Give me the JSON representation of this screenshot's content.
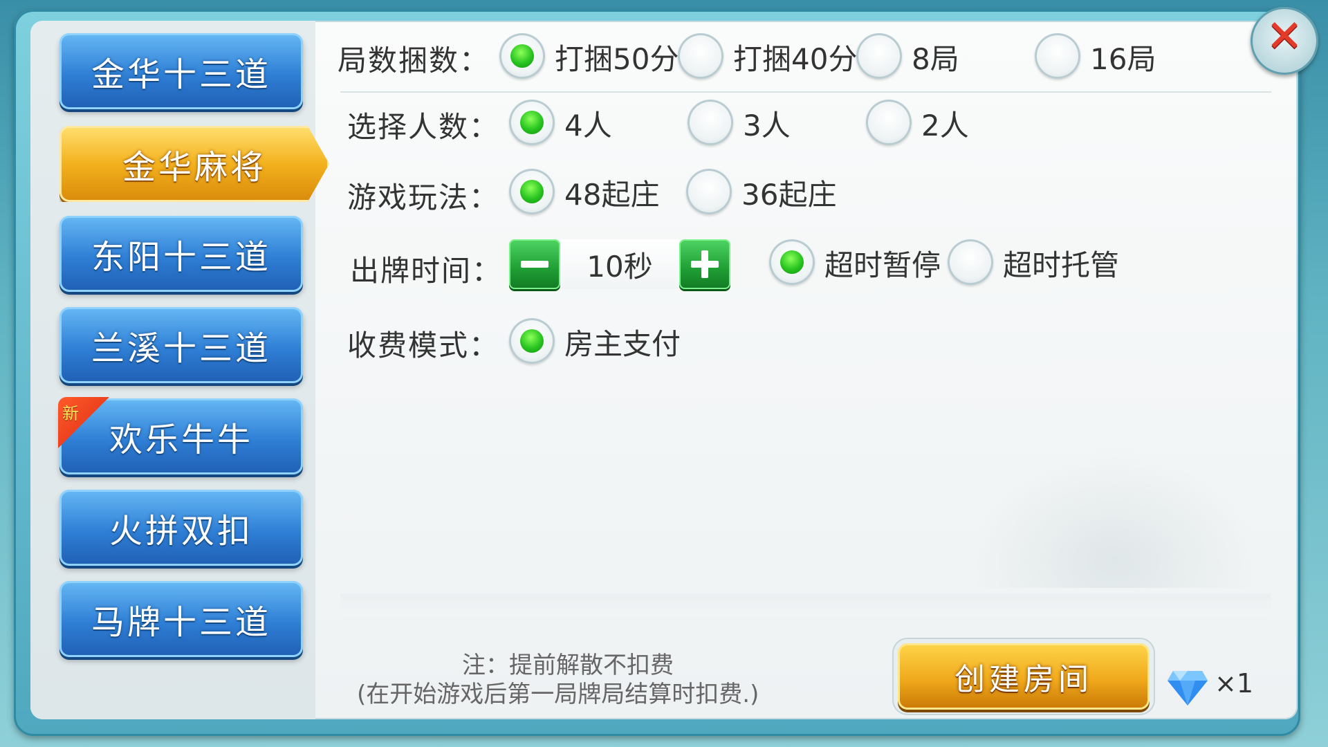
{
  "sidebar": {
    "items": [
      {
        "label": "金华十三道",
        "active": false,
        "new": false
      },
      {
        "label": "金华麻将",
        "active": true,
        "new": false
      },
      {
        "label": "东阳十三道",
        "active": false,
        "new": false
      },
      {
        "label": "兰溪十三道",
        "active": false,
        "new": false
      },
      {
        "label": "欢乐牛牛",
        "active": false,
        "new": true,
        "badge": "新"
      },
      {
        "label": "火拼双扣",
        "active": false,
        "new": false
      },
      {
        "label": "马牌十三道",
        "active": false,
        "new": false
      }
    ]
  },
  "options": {
    "rounds": {
      "label": "局数捆数：",
      "choices": [
        "打捆50分",
        "打捆40分",
        "8局",
        "16局"
      ],
      "selected": 0
    },
    "players": {
      "label": "选择人数：",
      "choices": [
        "4人",
        "3人",
        "2人"
      ],
      "selected": 0
    },
    "gameplay": {
      "label": "游戏玩法：",
      "choices": [
        "48起庄",
        "36起庄"
      ],
      "selected": 0
    },
    "play_time": {
      "label": "出牌时间：",
      "value": "10秒",
      "choices": [
        "超时暂停",
        "超时托管"
      ],
      "selected": 0
    },
    "fee_mode": {
      "label": "收费模式：",
      "choices": [
        "房主支付"
      ],
      "selected": 0
    }
  },
  "notes": {
    "line1": "注：提前解散不扣费",
    "line2": "(在开始游戏后第一局牌局结算时扣费.)"
  },
  "create_button": {
    "label": "创建房间"
  },
  "cost": {
    "icon": "diamond-icon",
    "count": "×1"
  },
  "close": {
    "icon": "close-icon",
    "glyph": "✕"
  },
  "colors": {
    "accent_blue": "#2f7fd6",
    "accent_gold": "#f3b11e",
    "radio_green": "#27c41f",
    "close_red": "#e43a2a"
  }
}
